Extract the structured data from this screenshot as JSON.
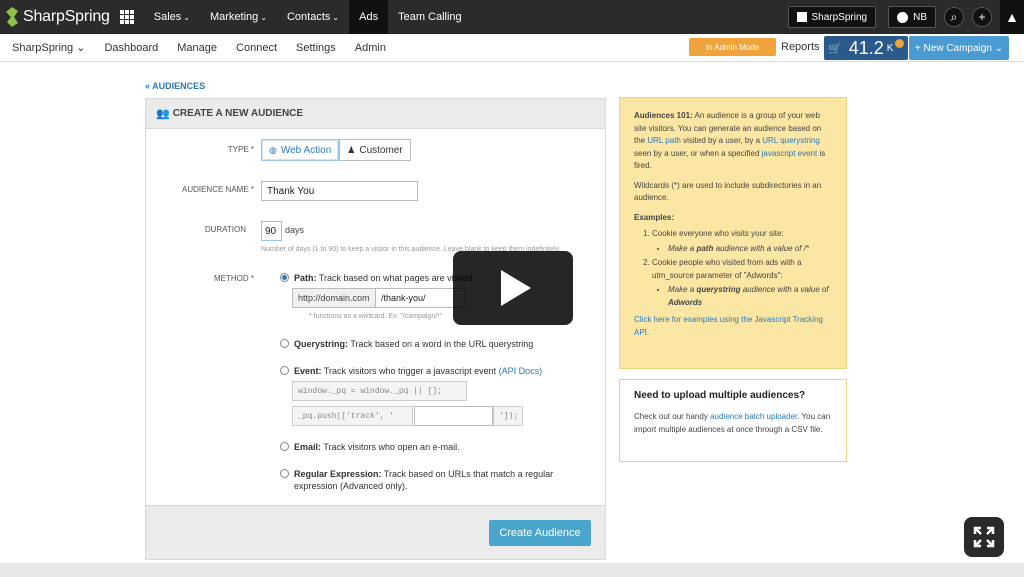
{
  "brand": {
    "name": "SharpSpring"
  },
  "topnav": {
    "items": [
      {
        "label": "Sales",
        "caret": "⌄"
      },
      {
        "label": "Marketing",
        "caret": "⌄"
      },
      {
        "label": "Contacts",
        "caret": "⌄"
      },
      {
        "label": "Ads",
        "caret": ""
      },
      {
        "label": "Team Calling",
        "caret": ""
      }
    ],
    "active": "Ads",
    "account_label": "SharpSpring",
    "user_initials": "NB"
  },
  "subnav": {
    "items": [
      "SharpSpring",
      "Dashboard",
      "Manage",
      "Connect",
      "Settings",
      "Admin"
    ],
    "admin_mode_label": "In Admin Mode",
    "reports_label": "Reports",
    "counter_value": "41.2",
    "counter_unit": "K",
    "new_campaign_label": "+ New Campaign ⌄"
  },
  "breadcrumb": "« AUDIENCES",
  "form": {
    "title": "CREATE A NEW AUDIENCE",
    "type_label": "TYPE *",
    "type_options": [
      "Web Action",
      "Customer"
    ],
    "audience_name_label": "AUDIENCE NAME *",
    "audience_name_value": "Thank You",
    "duration_label": "DURATION",
    "duration_value": "90",
    "duration_unit": "days",
    "duration_help": "Number of days (1 to 90) to keep a visitor in this audience. Leave blank to keep them indefinitely.",
    "method_label": "METHOD *",
    "path_bold": "Path:",
    "path_desc": "Track based on what pages are visited",
    "path_domain": "http://domain.com",
    "path_value": "/thank-you/",
    "path_help": "* functions as a wildcard. Ex. \"/campaign/*\"",
    "query_bold": "Querystring:",
    "query_desc": "Track based on a word in the URL querystring",
    "event_bold": "Event:",
    "event_desc": "Track visitors who trigger a javascript event",
    "event_link": "(API Docs)",
    "code_line1": "window._pq = window._pq || [];",
    "code_line2": "_pq.push(['track', '",
    "code_line2_end": "']);",
    "email_bold": "Email:",
    "email_desc": "Track visitors who open an e-mail.",
    "regex_bold": "Regular Expression:",
    "regex_desc": "Track based on URLs that match a regular expression (Advanced only).",
    "submit_label": "Create Audience"
  },
  "info101": {
    "title": "Audiences 101:",
    "intro_1": "An audience is a group of your web site visitors. You can generate an audience based on the",
    "link_url_path": "URL path",
    "intro_2": "visited by a user, by a",
    "link_url_query": "URL querystring",
    "intro_3": "seen by a user, or when a specified",
    "link_js_event": "javascript event",
    "intro_4": "is fired.",
    "wildcards": "Wildcards (*) are used to include subdirectories in an audience.",
    "examples_title": "Examples:",
    "ex1": "Cookie everyone who visits your site:",
    "ex1_sub_1": "Make a",
    "ex1_sub_bold": "path",
    "ex1_sub_2": "audience with a value of /*",
    "ex2": "Cookie people who visited from ads with a utm_source parameter of \"Adwords\":",
    "ex2_sub_1": "Make a",
    "ex2_sub_bold": "querystring",
    "ex2_sub_2": "audience with a value of",
    "ex2_sub_bold2": "Adwords",
    "js_api_link": "Click here for examples using the Javascript Tracking API."
  },
  "upload": {
    "title": "Need to upload multiple audiences?",
    "text_1": "Check out our handy",
    "link": "audience batch uploader",
    "text_2": ". You can import multiple audiences at once through a CSV file."
  },
  "colors": {
    "topbar": "#2b2b2b",
    "accent": "#2a7ab8",
    "admin_mode": "#f0a33a",
    "counter": "#2a5a8c",
    "new_campaign": "#4a9bd1",
    "create_button": "#4aa5cc",
    "info_bg": "#fce6a4"
  },
  "icons": [
    "sharpspring-logo-icon",
    "apps-grid-icon",
    "user-avatar-icon",
    "search-icon",
    "plus-icon",
    "rocket-icon",
    "users-icon",
    "globe-icon",
    "person-icon",
    "basket-icon",
    "play-icon",
    "fullscreen-icon"
  ]
}
